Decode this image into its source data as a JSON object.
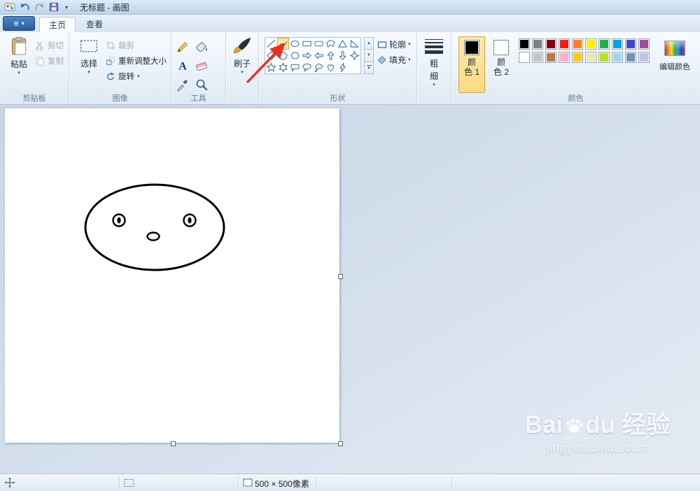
{
  "window": {
    "title": "无标题 - 画图"
  },
  "quick_access": {
    "icons": [
      "paint-logo",
      "undo",
      "redo",
      "save",
      "customize-dropdown"
    ]
  },
  "tabs": {
    "home": "主页",
    "view": "查看"
  },
  "ribbon": {
    "clipboard": {
      "group_label": "剪贴板",
      "paste": "粘贴",
      "cut": "剪切",
      "copy": "复制"
    },
    "image": {
      "group_label": "图像",
      "select": "选择",
      "crop": "裁剪",
      "resize": "重新调整大小",
      "rotate": "旋转"
    },
    "tools": {
      "group_label": "工具",
      "items": [
        "pencil",
        "fill",
        "text",
        "eraser",
        "color-picker",
        "magnifier"
      ]
    },
    "brushes": {
      "button_label": "刷子"
    },
    "shapes": {
      "group_label": "形状",
      "outline_label": "轮廓",
      "fill_label": "填充",
      "selected": "curve",
      "items": [
        "line",
        "curve",
        "oval",
        "rectangle",
        "rounded-rectangle",
        "polygon",
        "triangle",
        "right-triangle",
        "diamond",
        "pentagon",
        "hexagon",
        "right-arrow",
        "left-arrow",
        "up-arrow",
        "down-arrow",
        "four-point-star",
        "five-point-star",
        "six-point-star",
        "rounded-callout",
        "oval-callout",
        "cloud-callout",
        "heart",
        "lightning"
      ]
    },
    "size": {
      "label_line1": "粗",
      "label_line2": "细"
    },
    "colors": {
      "group_label": "颜色",
      "color1": {
        "label_line1": "颜",
        "label_line2": "色 1",
        "value": "#000000"
      },
      "color2": {
        "label_line1": "颜",
        "label_line2": "色 2",
        "value": "#ffffff"
      },
      "edit_label": "编辑颜色",
      "palette": [
        [
          "#000000",
          "#7f7f7f",
          "#880015",
          "#ed1c24",
          "#ff7f27",
          "#fff200",
          "#22b14c",
          "#00a2e8",
          "#3f48cc",
          "#a349a4"
        ],
        [
          "#ffffff",
          "#c3c3c3",
          "#b97a57",
          "#ffaec9",
          "#ffc90e",
          "#efe4b0",
          "#b5e61d",
          "#99d9ea",
          "#7092be",
          "#c8bfe7"
        ]
      ]
    }
  },
  "annotation": {
    "arrow_color": "#e8301c",
    "points_to": "curve-shape"
  },
  "status_bar": {
    "canvas_size": "500 × 500像素"
  },
  "watermark": {
    "brand_prefix": "Bai",
    "brand_suffix": "du",
    "brand_cn": "经验",
    "url": "jingyan.baidu.com"
  }
}
